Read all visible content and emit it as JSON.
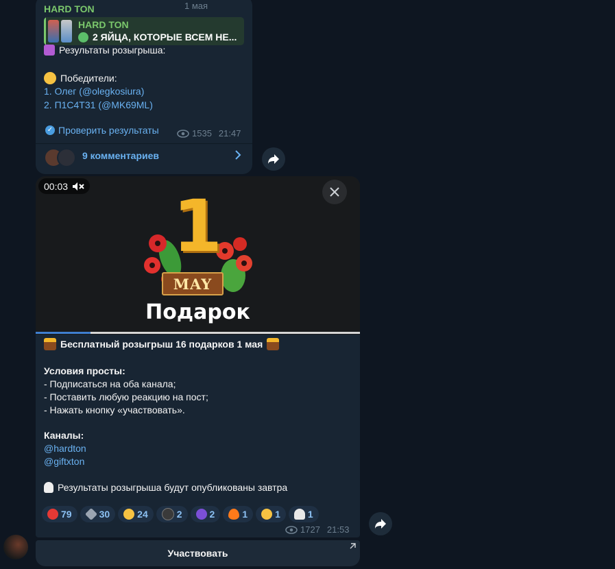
{
  "post1": {
    "date_label": "1 мая",
    "channel": "HARD TON",
    "reply": {
      "channel": "HARD TON",
      "text": "2 ЯЙЦА, КОТОРЫЕ ВСЕМ НЕ..."
    },
    "results_label": "Результаты розыгрыша:",
    "winners_label": "Победители:",
    "winners": [
      "1. Олег (@olegkosiura)",
      "2. П1С4Т31 (@MK69ML)"
    ],
    "verify_link": "Проверить результаты",
    "views": "1535",
    "time": "21:47",
    "comments_label": "9 комментариев"
  },
  "post2": {
    "video": {
      "timer": "00:03",
      "big_number": "1",
      "badge_text": "MAY",
      "caption": "Подарок",
      "progress": 0.17
    },
    "headline": "Бесплатный розыгрыш 16 подарков 1 мая",
    "conditions_title": "Условия просты:",
    "conditions": [
      "- Подписаться на оба канала;",
      "- Поставить любую реакцию на пост;",
      "- Нажать кнопку «участвовать»."
    ],
    "channels_title": "Каналы:",
    "channels": [
      "@hardton",
      "@giftxton"
    ],
    "results_note": "Результаты розыгрыша будут опубликованы завтра",
    "reactions": [
      {
        "icon": "heart-icon",
        "count": "79",
        "color": "#e53935"
      },
      {
        "icon": "gem-icon",
        "count": "30",
        "color": "#9aa4b1"
      },
      {
        "icon": "thumbs-up-icon",
        "count": "24",
        "color": "#f6c242"
      },
      {
        "icon": "bomb-icon",
        "count": "2",
        "color": "#3a3a3a"
      },
      {
        "icon": "wizard-icon",
        "count": "2",
        "color": "#7b4fd6"
      },
      {
        "icon": "fire-icon",
        "count": "1",
        "color": "#ff7a1a"
      },
      {
        "icon": "grin-icon",
        "count": "1",
        "color": "#f6c242"
      },
      {
        "icon": "ghost-icon",
        "count": "1",
        "color": "#e8e8e8"
      }
    ],
    "views": "1727",
    "time": "21:53",
    "participate_button": "Участвовать"
  },
  "colors": {
    "background": "#0e1621",
    "bubble": "#182533",
    "link": "#6ab2f2",
    "channel_name": "#7bc86c"
  }
}
